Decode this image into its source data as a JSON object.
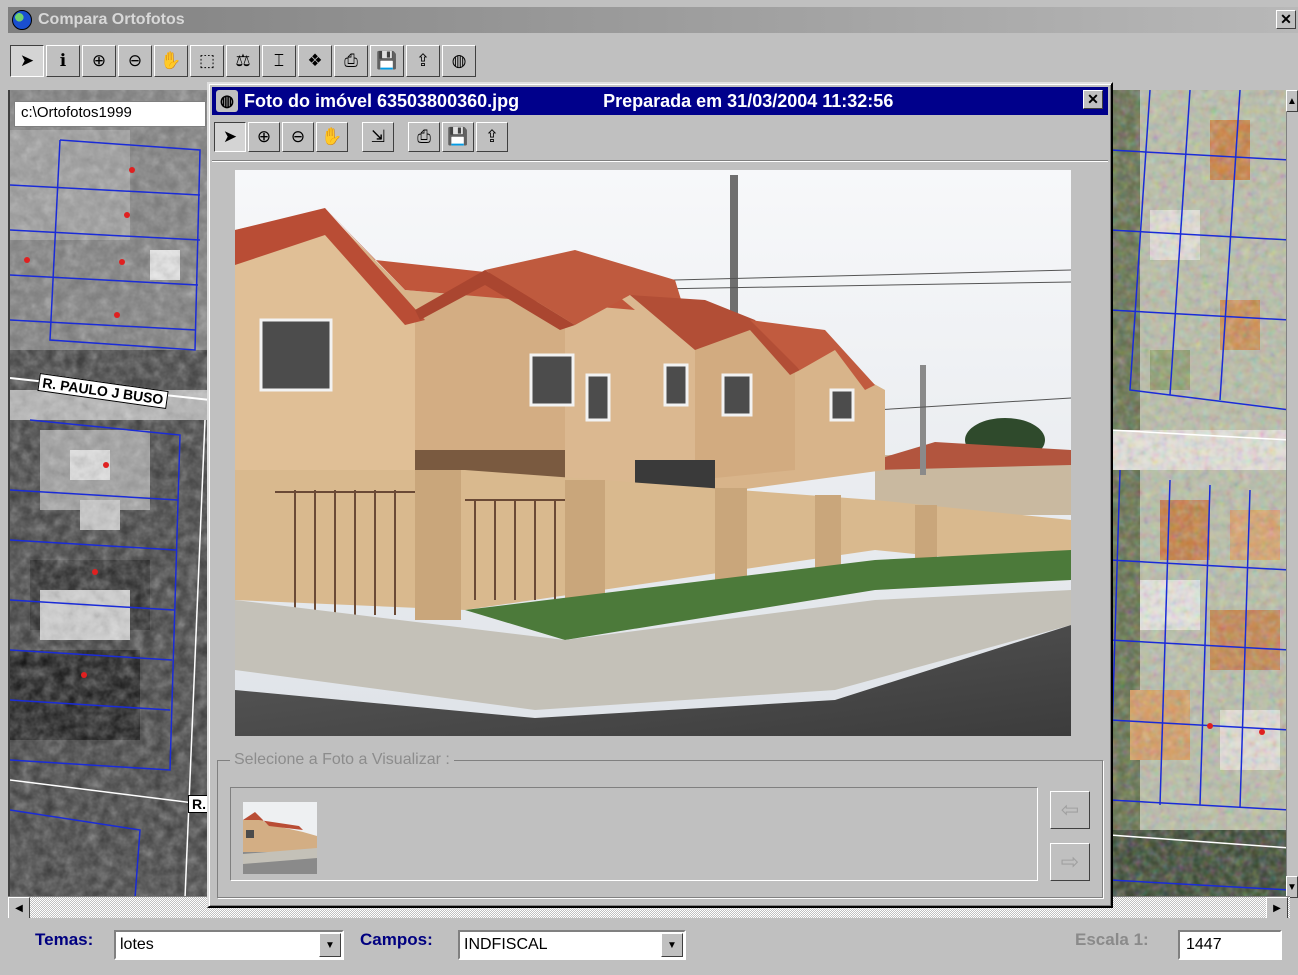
{
  "window": {
    "title": "Compara Ortofotos",
    "close_glyph": "✕"
  },
  "main_toolbar": [
    {
      "name": "pointer-tool-button",
      "icon": "pointer-icon",
      "glyph": "➤"
    },
    {
      "name": "info-tool-button",
      "icon": "info-icon",
      "glyph": "ℹ"
    },
    {
      "name": "zoom-in-button",
      "icon": "zoom-in-icon",
      "glyph": "⊕"
    },
    {
      "name": "zoom-out-button",
      "icon": "zoom-out-icon",
      "glyph": "⊖"
    },
    {
      "name": "pan-tool-button",
      "icon": "hand-icon",
      "glyph": "✋"
    },
    {
      "name": "select-area-button",
      "icon": "select-area-icon",
      "glyph": "⬚"
    },
    {
      "name": "scale-button",
      "icon": "scale-icon",
      "glyph": "⚖"
    },
    {
      "name": "label-button",
      "icon": "label-icon",
      "glyph": "⌶"
    },
    {
      "name": "layers-button",
      "icon": "layers-icon",
      "glyph": "❖"
    },
    {
      "name": "print-button",
      "icon": "printer-icon",
      "glyph": "⎙"
    },
    {
      "name": "save-button",
      "icon": "floppy-icon",
      "glyph": "💾"
    },
    {
      "name": "export-button",
      "icon": "export-icon",
      "glyph": "⇪"
    },
    {
      "name": "photo-button",
      "icon": "camera-icon",
      "glyph": "◍"
    }
  ],
  "map": {
    "path_label": "c:\\Ortofotos1999",
    "street_1": "R. PAULO J BUSO",
    "street_2": "R."
  },
  "dialog": {
    "title": "Foto do imóvel 63503800360.jpg",
    "prepared": "Preparada em 31/03/2004 11:32:56",
    "close_glyph": "✕",
    "toolbar": [
      {
        "name": "dlg-pointer-button",
        "icon": "pointer-icon",
        "glyph": "➤"
      },
      {
        "name": "dlg-zoom-in-button",
        "icon": "zoom-in-icon",
        "glyph": "⊕"
      },
      {
        "name": "dlg-zoom-out-button",
        "icon": "zoom-out-icon",
        "glyph": "⊖"
      },
      {
        "name": "dlg-pan-button",
        "icon": "hand-icon",
        "glyph": "✋"
      },
      {
        "name": "dlg-fit-button",
        "icon": "fit-icon",
        "glyph": "⇲"
      },
      {
        "name": "dlg-print-button",
        "icon": "printer-icon",
        "glyph": "⎙"
      },
      {
        "name": "dlg-save-button",
        "icon": "floppy-icon",
        "glyph": "💾"
      },
      {
        "name": "dlg-export-button",
        "icon": "export-icon",
        "glyph": "⇪"
      }
    ],
    "group_label": "Selecione a Foto a Visualizar :",
    "prev_glyph": "⇦",
    "next_glyph": "⇨"
  },
  "bottom": {
    "temas_label": "Temas:",
    "temas_value": "lotes",
    "campos_label": "Campos:",
    "campos_value": "INDFISCAL",
    "escala_label": "Escala 1:",
    "escala_value": "1447",
    "dropdown_glyph": "▼"
  },
  "scroll": {
    "left_glyph": "◀",
    "right_glyph": "▶"
  }
}
